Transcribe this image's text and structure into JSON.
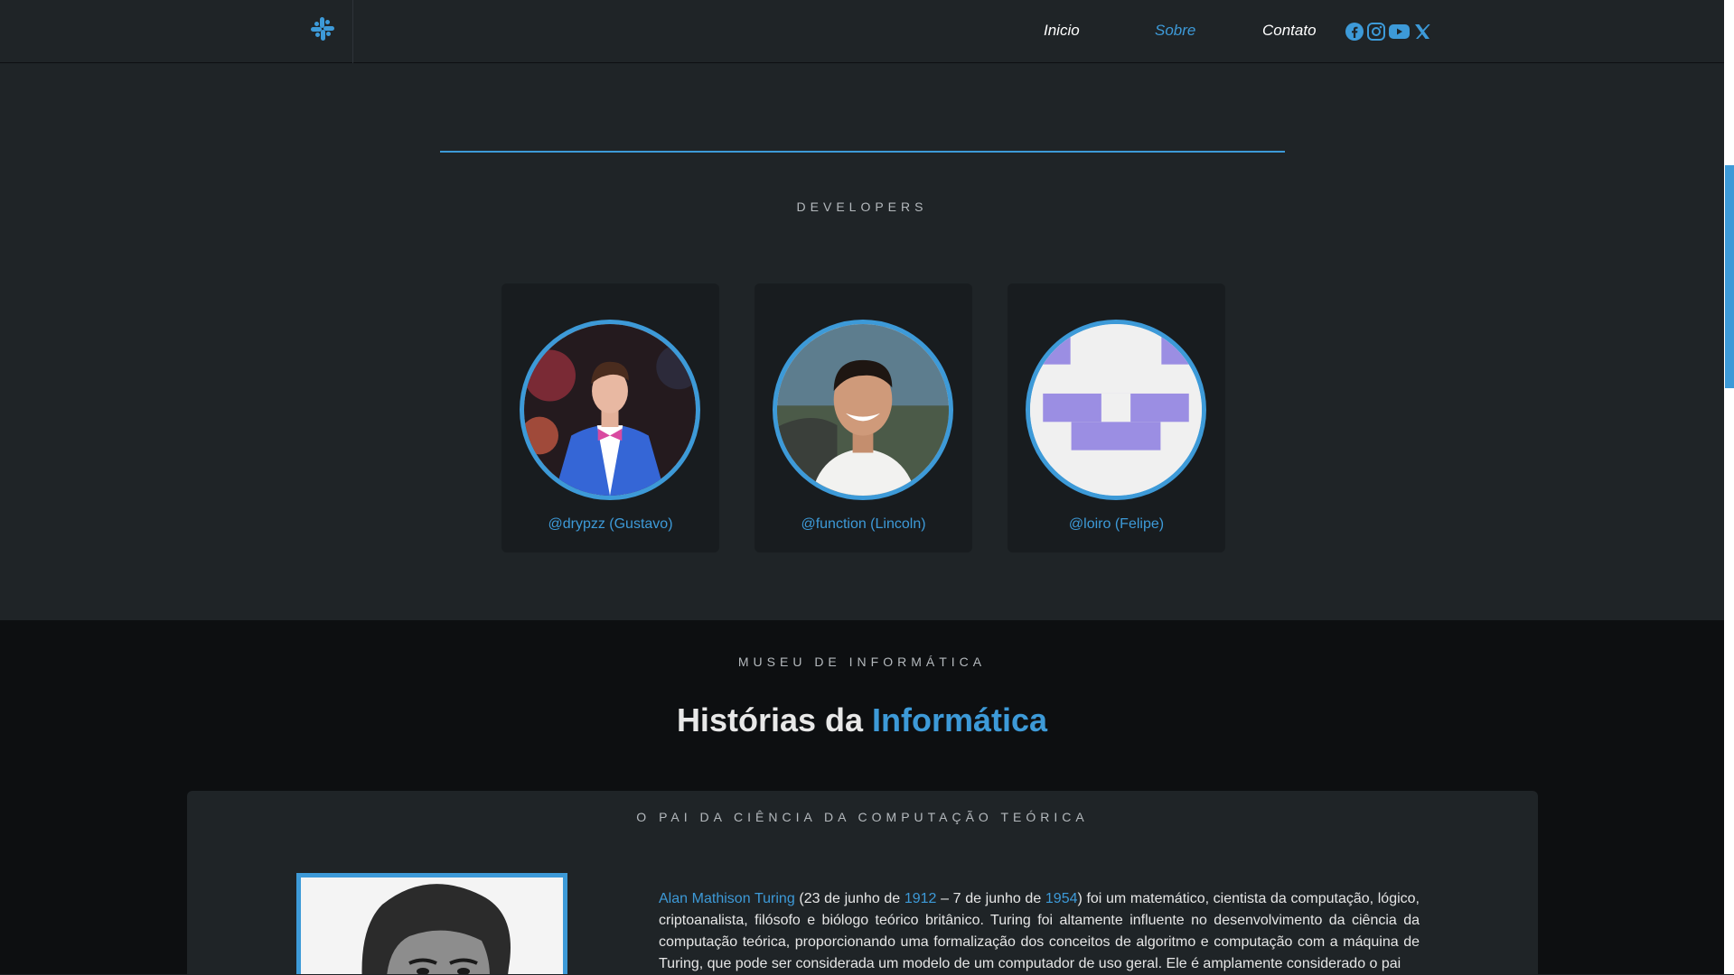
{
  "nav": {
    "logo": "slack-icon",
    "links": [
      {
        "label": "Inicio",
        "active": false
      },
      {
        "label": "Sobre",
        "active": true
      },
      {
        "label": "Contato",
        "active": false
      }
    ],
    "social": [
      "facebook-icon",
      "instagram-icon",
      "youtube-icon",
      "x-icon"
    ]
  },
  "developers": {
    "heading": "DEVELOPERS",
    "members": [
      {
        "name": "@drypzz (Gustavo)"
      },
      {
        "name": "@function (Lincoln)"
      },
      {
        "name": "@loiro (Felipe)"
      }
    ]
  },
  "museum": {
    "kicker": "MUSEU DE INFORMÁTICA",
    "title_plain": "Histórias da ",
    "title_highlight": "Informática",
    "card": {
      "kicker": "O PAI DA CIÊNCIA DA COMPUTAÇÃO TEÓRICA",
      "bio": {
        "name_link": "Alan Mathison Turing",
        "t1": " (23 de junho de ",
        "year_born": "1912",
        "t2": " – 7 de junho de ",
        "year_died": "1954",
        "t3": ") foi um matemático, cientista da computação, lógico, criptoanalista, filósofo e biólogo teórico britânico. Turing foi altamente influente no desenvolvimento da ciência da computação teórica, proporcionando uma formalização dos conceitos de algoritmo e computação com a máquina de Turing, que pode ser considerada um modelo de um computador de uso geral. Ele é amplamente considerado o pai"
      }
    }
  },
  "colors": {
    "accent": "#3d9ad8",
    "background": "#1f2427",
    "dark_section": "#0d0f11",
    "card": "#181c1f"
  }
}
